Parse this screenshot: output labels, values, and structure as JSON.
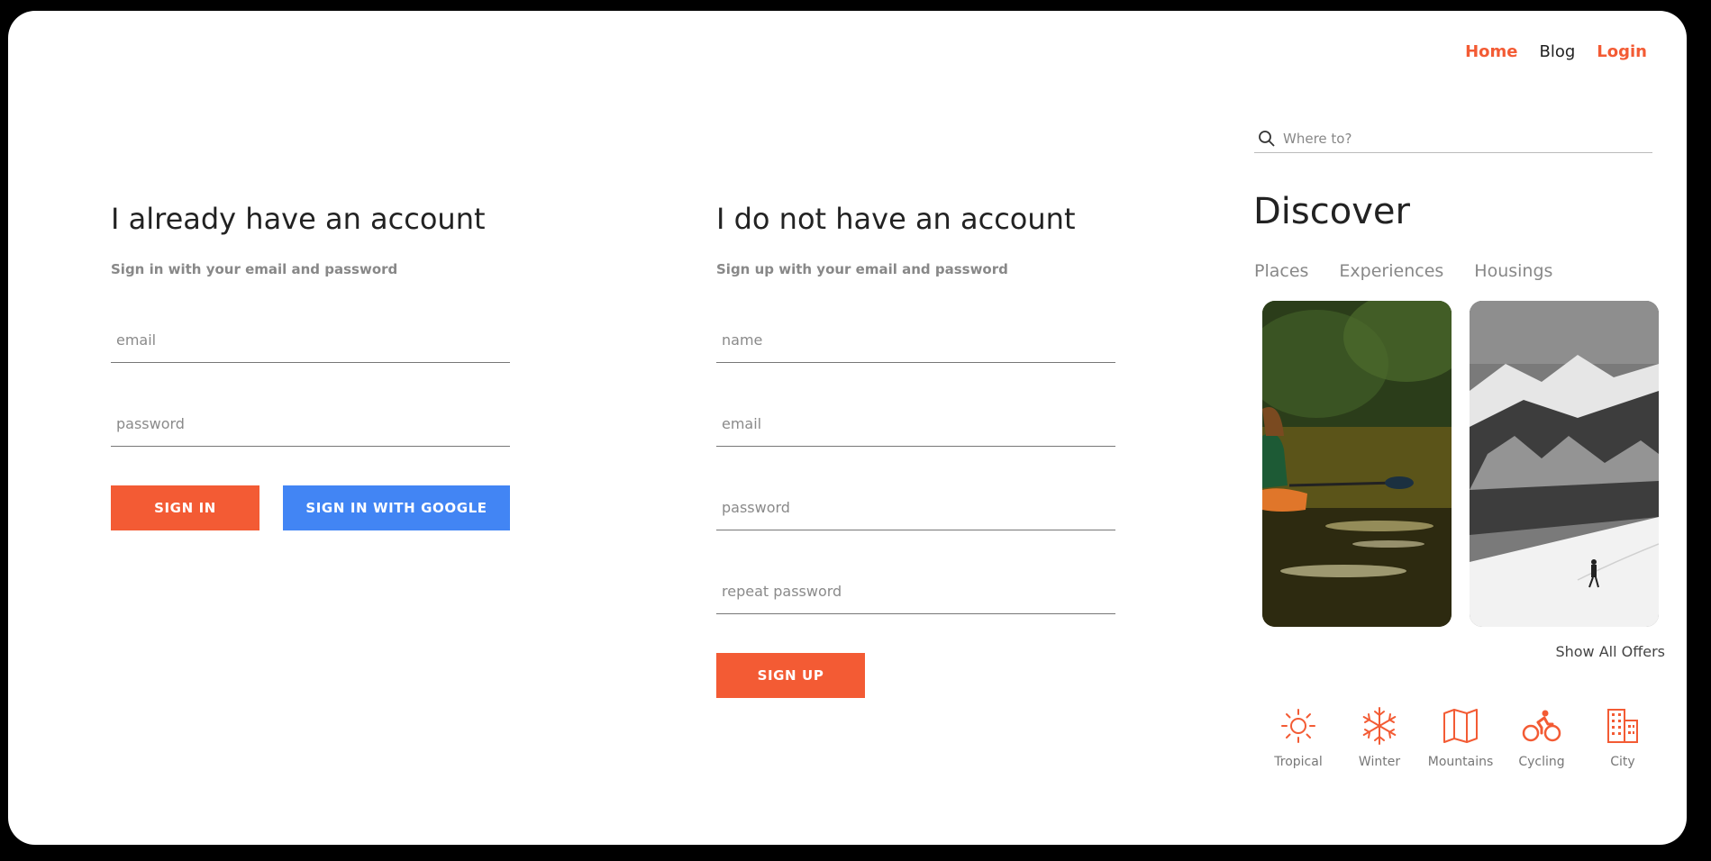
{
  "nav": {
    "home": "Home",
    "blog": "Blog",
    "login": "Login"
  },
  "signin": {
    "title": "I already have an account",
    "subtitle": "Sign in with your email and password",
    "email_placeholder": "email",
    "password_placeholder": "password",
    "signin_label": "SIGN IN",
    "google_label": "SIGN IN WITH GOOGLE"
  },
  "signup": {
    "title": "I do not have an account",
    "subtitle": "Sign up with your email and password",
    "name_placeholder": "name",
    "email_placeholder": "email",
    "password_placeholder": "password",
    "repeat_placeholder": "repeat password",
    "signup_label": "SIGN UP"
  },
  "sidebar": {
    "search_placeholder": "Where to?",
    "heading": "Discover",
    "tabs": [
      "Places",
      "Experiences",
      "Housings"
    ],
    "show_all": "Show All Offers",
    "categories": [
      {
        "label": "Tropical",
        "icon": "sun-icon"
      },
      {
        "label": "Winter",
        "icon": "snowflake-icon"
      },
      {
        "label": "Mountains",
        "icon": "map-icon"
      },
      {
        "label": "Cycling",
        "icon": "bicycle-icon"
      },
      {
        "label": "City",
        "icon": "building-icon"
      }
    ]
  },
  "colors": {
    "accent": "#f35b34",
    "google": "#4285f4"
  }
}
